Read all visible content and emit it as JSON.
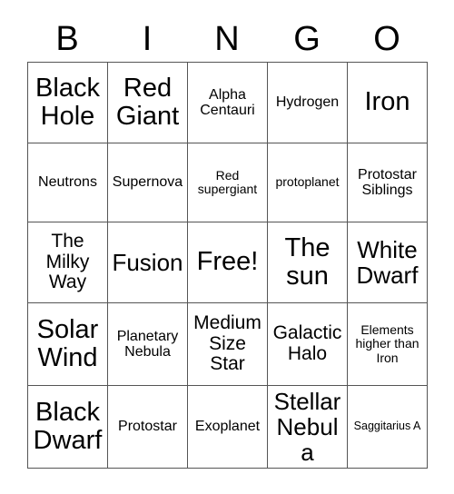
{
  "card": {
    "header_letters": [
      "B",
      "I",
      "N",
      "G",
      "O"
    ],
    "grid": {
      "columns": 5,
      "rows": 5,
      "border_color": "#555555",
      "background_color": "#ffffff",
      "text_color": "#000000"
    },
    "cells": [
      {
        "text": "Black Hole",
        "size": "s-xl"
      },
      {
        "text": "Red Giant",
        "size": "s-xl"
      },
      {
        "text": "Alpha Centauri",
        "size": "s-sm"
      },
      {
        "text": "Hydrogen",
        "size": "s-sm"
      },
      {
        "text": "Iron",
        "size": "s-xl"
      },
      {
        "text": "Neutrons",
        "size": "s-sm"
      },
      {
        "text": "Supernova",
        "size": "s-sm"
      },
      {
        "text": "Red supergiant",
        "size": "s-xs"
      },
      {
        "text": "protoplanet",
        "size": "s-xs"
      },
      {
        "text": "Protostar Siblings",
        "size": "s-sm"
      },
      {
        "text": "The Milky Way",
        "size": "s-md"
      },
      {
        "text": "Fusion",
        "size": "s-lg"
      },
      {
        "text": "Free!",
        "size": "s-xl"
      },
      {
        "text": "The sun",
        "size": "s-xl"
      },
      {
        "text": "White Dwarf",
        "size": "s-lg"
      },
      {
        "text": "Solar Wind",
        "size": "s-xl"
      },
      {
        "text": "Planetary Nebula",
        "size": "s-sm"
      },
      {
        "text": "Medium Size Star",
        "size": "s-md"
      },
      {
        "text": "Galactic Halo",
        "size": "s-md"
      },
      {
        "text": "Elements higher than Iron",
        "size": "s-xs"
      },
      {
        "text": "Black Dwarf",
        "size": "s-xl"
      },
      {
        "text": "Protostar",
        "size": "s-sm"
      },
      {
        "text": "Exoplanet",
        "size": "s-sm"
      },
      {
        "text": "Stellar Nebula",
        "size": "s-lg"
      },
      {
        "text": "Saggitarius A",
        "size": "s-xxs"
      }
    ]
  }
}
